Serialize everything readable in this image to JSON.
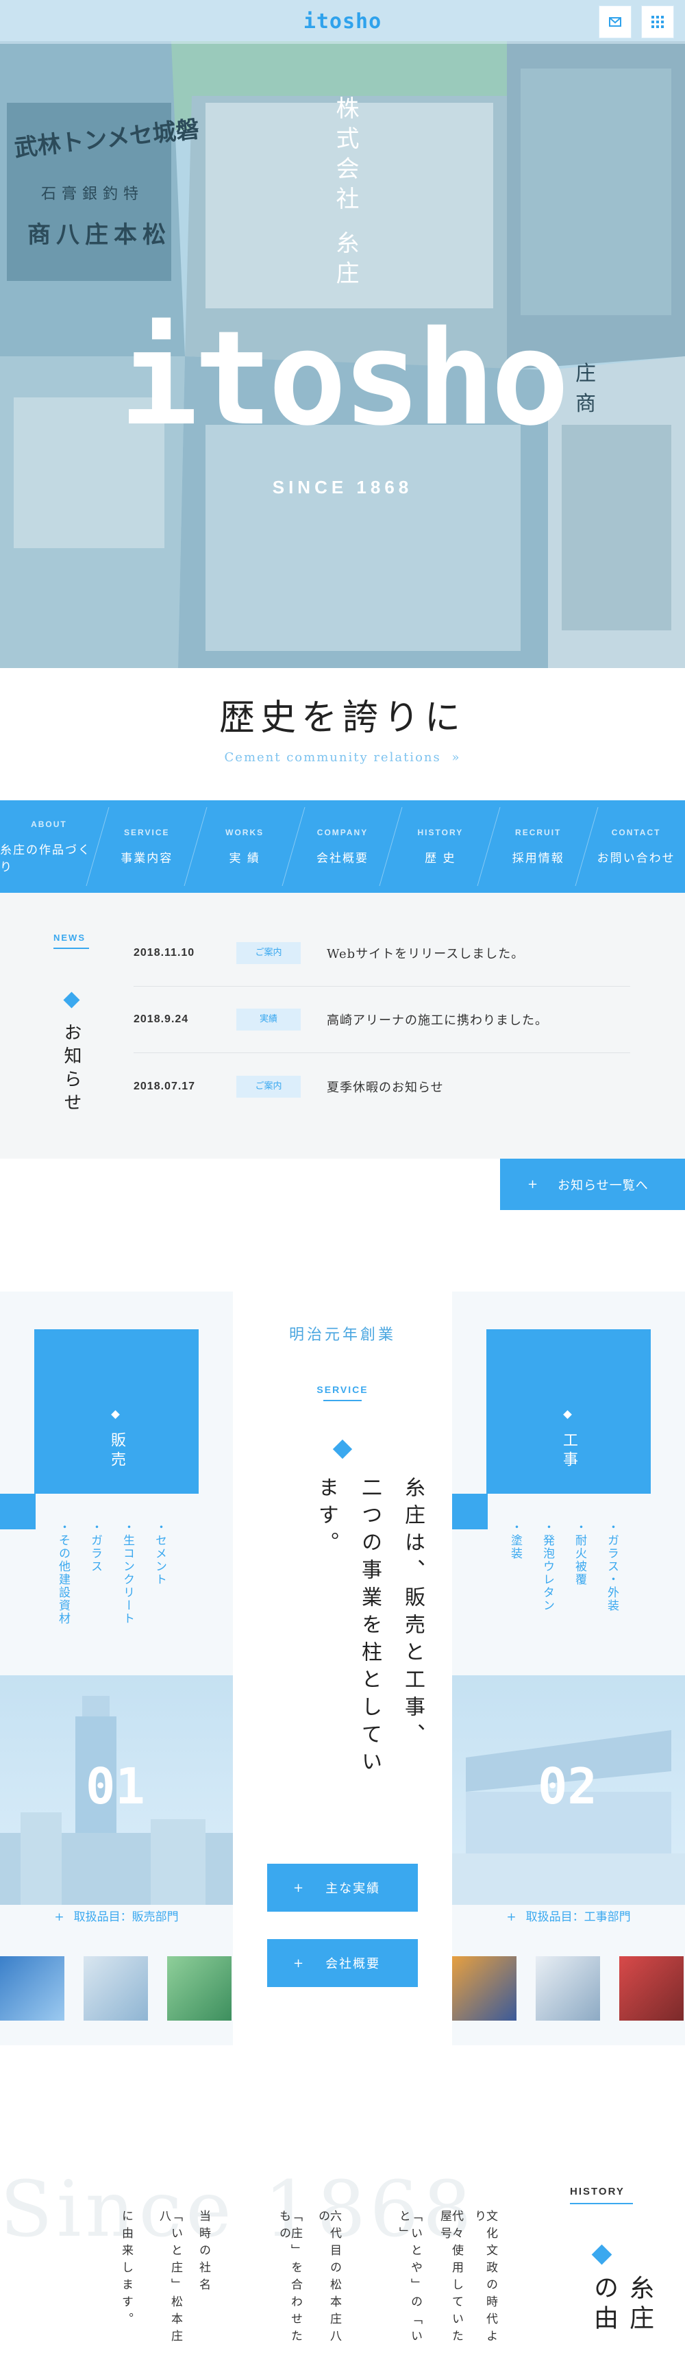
{
  "header": {
    "logo": "itosho"
  },
  "hero": {
    "plaque_vertical": "株式会社 糸庄",
    "sign_left": "武林トンメセ城磐",
    "sign_left2": "石膏銀釣特",
    "sign_left3": "商八庄本松",
    "sign_right": "庄 商",
    "main_text": "itosho",
    "since": "SINCE 1868"
  },
  "tagline": {
    "title": "歴史を誇りに",
    "subtitle": "Cement community relations"
  },
  "nav": [
    {
      "en": "ABOUT",
      "ja": "糸庄の作品づくり"
    },
    {
      "en": "SERVICE",
      "ja": "事業内容"
    },
    {
      "en": "WORKS",
      "ja": "実 績"
    },
    {
      "en": "COMPANY",
      "ja": "会社概要"
    },
    {
      "en": "HISTORY",
      "ja": "歴 史"
    },
    {
      "en": "RECRUIT",
      "ja": "採用情報"
    },
    {
      "en": "CONTACT",
      "ja": "お問い合わせ"
    }
  ],
  "news": {
    "label": "NEWS",
    "title": "お知らせ",
    "items": [
      {
        "date": "2018.11.10",
        "category": "ご案内",
        "text": "Webサイトをリリースしました。"
      },
      {
        "date": "2018.9.24",
        "category": "実績",
        "text": "高崎アリーナの施工に携わりました。"
      },
      {
        "date": "2018.07.17",
        "category": "ご案内",
        "text": "夏季休暇のお知らせ"
      }
    ],
    "more": "お知らせ一覧へ"
  },
  "service": {
    "lead": "明治元年創業",
    "label": "SERVICE",
    "copy_lines": [
      "糸庄は、販売と工事、",
      "二つの事業を柱としています。"
    ],
    "btn_works": "主な実績",
    "btn_company": "会社概要",
    "left": {
      "title": "販売",
      "items": [
        "セメント",
        "生コンクリート",
        "ガラス",
        "その他建設資材"
      ],
      "number": "01",
      "link": "取扱品目：販売部門"
    },
    "right": {
      "title": "工事",
      "items": [
        "ガラス・外装",
        "耐火被覆",
        "発泡ウレタン",
        "塗装"
      ],
      "number": "02",
      "link": "取扱品目：工事部門"
    }
  },
  "history": {
    "bg_text": "Since 1868",
    "label": "HISTORY",
    "title": "糸庄の由",
    "columns": [
      "文化文政の時代より",
      "代々使用していた屋号",
      "「いとや」の「いと」",
      "六代目の松本庄八の",
      "「庄」を合わせたもの",
      "当時の社名",
      "「いと庄」松本庄八",
      "に由来します。"
    ]
  },
  "colors": {
    "accent": "#3aa8ef",
    "hero_tint": "#a9cfe0"
  }
}
